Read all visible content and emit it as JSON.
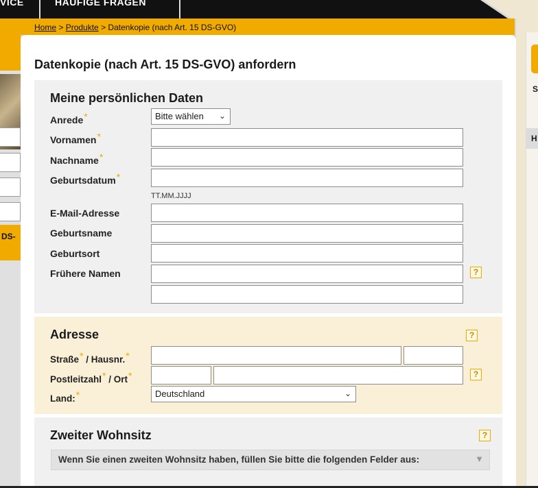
{
  "nav": {
    "items": [
      {
        "label": "VICE"
      },
      {
        "label": "HÄUFIGE FRAGEN"
      }
    ]
  },
  "breadcrumb": {
    "home": "Home",
    "sep1": " > ",
    "products": "Produkte",
    "sep2": " > ",
    "current": "Datenkopie (nach Art. 15 DS-GVO)"
  },
  "left_sidebar": {
    "tab_label": "DS-"
  },
  "right_sidebar": {
    "s_label": "S",
    "h_label": "H"
  },
  "page_title": "Datenkopie (nach Art. 15 DS-GVO) anfordern",
  "personal": {
    "title": "Meine persönlichen Daten",
    "required_mark": "*",
    "anrede_label": "Anrede",
    "anrede_value": "Bitte wählen",
    "vornamen_label": "Vornamen",
    "nachname_label": "Nachname",
    "geburtsdatum_label": "Geburtsdatum",
    "geburtsdatum_hint": "TT.MM.JJJJ",
    "email_label": "E-Mail-Adresse",
    "geburtsname_label": "Geburtsname",
    "geburtsort_label": "Geburtsort",
    "fruehere_namen_label": "Frühere Namen",
    "help": "?"
  },
  "address": {
    "title": "Adresse",
    "street_label": "Straße",
    "housenr_label": " / Hausnr.",
    "plz_label": "Postleitzahl",
    "ort_label": " / Ort",
    "land_label": "Land:",
    "land_value": "Deutschland",
    "help": "?"
  },
  "second_residence": {
    "title": "Zweiter Wohnsitz",
    "expander_text": "Wenn Sie einen zweiten Wohnsitz haben, füllen Sie bitte die folgenden Felder aus:",
    "help": "?"
  },
  "colors": {
    "accent": "#f0aa00",
    "nav_bg": "#111111",
    "address_bg": "#faf0d8",
    "section_bg": "#f0f0f0"
  }
}
